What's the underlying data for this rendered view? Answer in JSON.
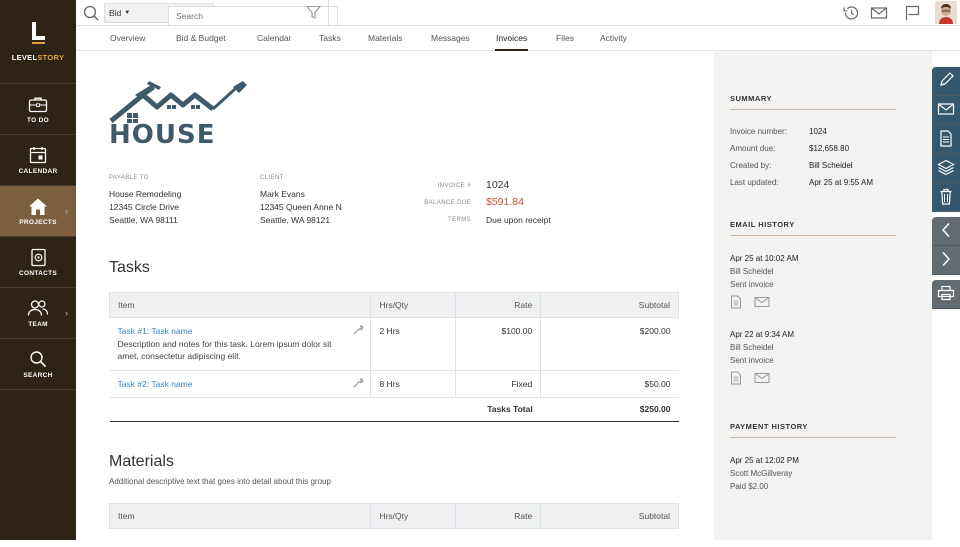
{
  "brand": {
    "name_left": "LEVEL",
    "name_right": "STORY"
  },
  "sidebar": {
    "items": [
      {
        "label": "TO DO",
        "icon": "briefcase-icon"
      },
      {
        "label": "CALENDAR",
        "icon": "calendar-icon"
      },
      {
        "label": "PROJECTS",
        "icon": "home-icon",
        "active": true,
        "arrow": "›"
      },
      {
        "label": "CONTACTS",
        "icon": "contact-book-icon"
      },
      {
        "label": "TEAM",
        "icon": "team-icon",
        "arrow": "›"
      },
      {
        "label": "SEARCH",
        "icon": "search-icon"
      }
    ]
  },
  "topbar": {
    "scope_value": "Bid",
    "search_placeholder": "Search"
  },
  "tabs": [
    "Overview",
    "Bid & Budget",
    "Calendar",
    "Tasks",
    "Materials",
    "Messages",
    "Invoices",
    "Files",
    "Activity"
  ],
  "invoice": {
    "logo_text": "HOUSE",
    "payable_to_label": "PAYABLE TO",
    "payable_to": [
      "House Remodeling",
      "12345 Circle Drive",
      "Seattle, WA 98111"
    ],
    "client_label": "CLIENT",
    "client": [
      "Mark Evans",
      "12345 Queen Anne N",
      "Seattle, WA 98121"
    ],
    "invoice_no_label": "INVOICE #",
    "invoice_no": "1024",
    "balance_due_label": "BALANCE DUE",
    "balance_due": "$591.84",
    "terms_label": "TERMS",
    "terms": "Due upon receipt"
  },
  "tasks_section": {
    "title": "Tasks",
    "columns": [
      "Item",
      "Hrs/Qty",
      "Rate",
      "Subtotal"
    ],
    "rows": [
      {
        "name": "Task #1: Task name",
        "desc": "Description and notes for this task. Lorem ipsum dolor sit amet, consectetur adipiscing elit.",
        "qty": "2 Hrs",
        "rate": "$100.00",
        "subtotal": "$200.00"
      },
      {
        "name": "Task #2: Task name",
        "desc": "",
        "qty": "8 Hrs",
        "rate": "Fixed",
        "subtotal": "$50.00"
      }
    ],
    "total_label": "Tasks Total",
    "total": "$250.00"
  },
  "materials_section": {
    "title": "Materials",
    "subtitle": "Additional descriptive text that goes into detail about this group",
    "columns": [
      "Item",
      "Hrs/Qty",
      "Rate",
      "Subtotal"
    ]
  },
  "summary": {
    "title": "SUMMARY",
    "rows": [
      {
        "label": "Invoice number:",
        "value": "1024"
      },
      {
        "label": "Amount due:",
        "value": "$12,658.80"
      },
      {
        "label": "Created by:",
        "value": "Bill Scheidel"
      },
      {
        "label": "Last updated:",
        "value": "Apr 25 at 9:55 AM"
      }
    ]
  },
  "email_history": {
    "title": "EMAIL HISTORY",
    "entries": [
      {
        "date": "Apr 25 at 10:02 AM",
        "by": "Bill Scheidel",
        "action": "Sent invoice"
      },
      {
        "date": "Apr 22 at 9:34 AM",
        "by": "Bill Scheidel",
        "action": "Sent invoice"
      }
    ]
  },
  "payment_history": {
    "title": "PAYMENT HISTORY",
    "entries": [
      {
        "date": "Apr 25 at 12:02 PM",
        "by": "Scott McGillveray",
        "action": "Paid $2.00"
      }
    ]
  },
  "colors": {
    "sidebar_bg": "#2d2316",
    "active_nav": "#7b5f3e",
    "accent_gold": "#e2a33a",
    "link_blue": "#3a86c8",
    "balance_red": "#c0573a",
    "logo_slate": "#3e5a6b",
    "rail_blue": "#35586e",
    "rail_gray": "#626b70"
  }
}
